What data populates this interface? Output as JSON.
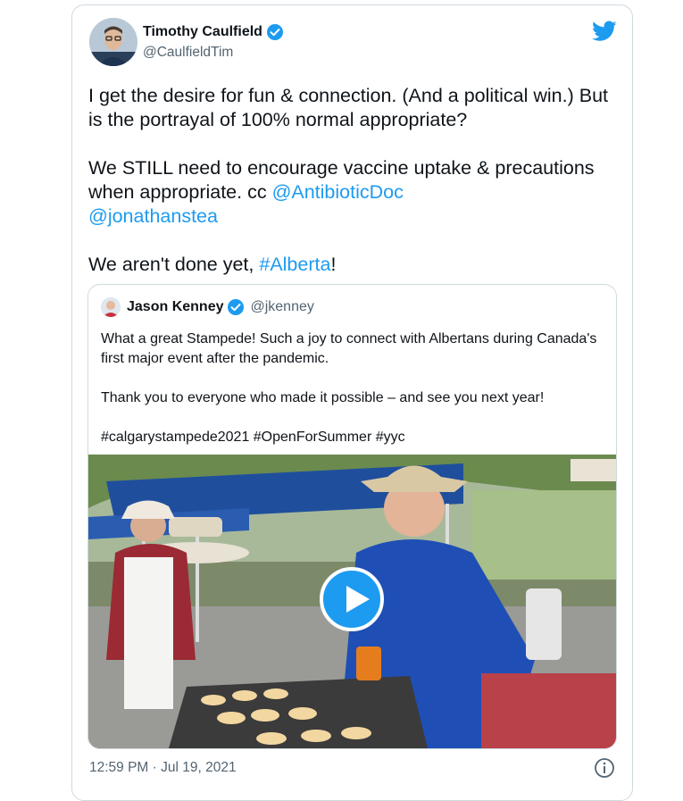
{
  "tweet": {
    "author_name": "Timothy Caulfield",
    "author_handle": "@CaulfieldTim",
    "para1": "I get the desire for fun & connection. (And a political win.) But is the portrayal of 100% normal appropriate?",
    "para2_text": "We STILL need to encourage vaccine uptake & precautions when appropriate. cc ",
    "mention1": "@AntibioticDoc",
    "mention2": "@jonathanstea",
    "para3_text": "We aren't done yet, ",
    "hashtag": "#Alberta",
    "para3_end": "!",
    "timestamp": "12:59 PM · Jul 19, 2021"
  },
  "quote": {
    "author_name": "Jason Kenney",
    "author_handle": "@jkenney",
    "para1": "What a great Stampede! Such a joy to connect with Albertans during Canada's first major event after the pandemic.",
    "para2": "Thank you to everyone who made it possible – and see you next year!",
    "para3": "#calgarystampede2021 #OpenForSummer #yyc"
  },
  "icons": {
    "verified": "verified-badge-icon",
    "brand": "twitter-bird-icon",
    "play": "play-icon",
    "info": "info-icon"
  },
  "colors": {
    "accent": "#1d9bf0",
    "text": "#0f1419",
    "secondary": "#536471",
    "border": "#cfd9de"
  }
}
